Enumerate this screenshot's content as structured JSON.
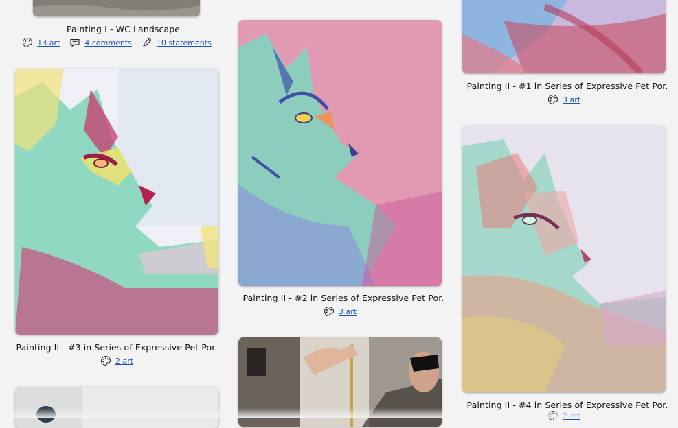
{
  "cards": {
    "c1": {
      "caption": "Painting I - WC Landscape",
      "art": "13 art",
      "comments": "4 comments",
      "statements": "10 statements"
    },
    "c2": {
      "caption": "Painting II - #3 in Series of Expressive Pet Por.",
      "art": "2 art"
    },
    "c3": {
      "caption": "Painting II - #2 in Series of Expressive Pet Por.",
      "art": "3 art"
    },
    "c4": {
      "caption": "Painting II - #1 in Series of Expressive Pet Por.",
      "art": "3 art"
    },
    "c5": {
      "caption": "Painting II - #4 in Series of Expressive Pet Por.",
      "art": "2 art"
    }
  },
  "icons": {
    "art": "palette-icon",
    "comments": "speech-bubble-icon",
    "statements": "pencil-icon"
  }
}
